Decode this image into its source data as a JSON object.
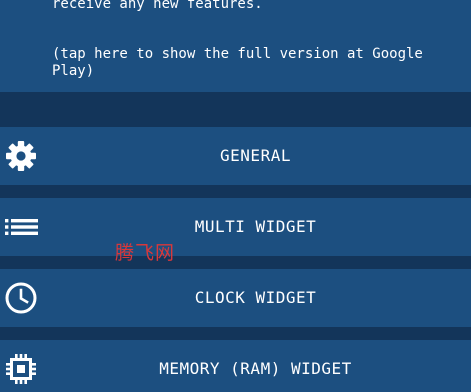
{
  "notice": {
    "line1": "receive any new features.",
    "line2": "(tap here to show the full version at Google",
    "line3": "Play)"
  },
  "menu": {
    "items": [
      {
        "label": "GENERAL",
        "icon": "gear-icon"
      },
      {
        "label": "MULTI WIDGET",
        "icon": "list-icon"
      },
      {
        "label": "CLOCK WIDGET",
        "icon": "clock-icon"
      },
      {
        "label": "MEMORY (RAM) WIDGET",
        "icon": "chip-icon"
      }
    ]
  },
  "watermark": "腾飞网",
  "colors": {
    "background": "#13355a",
    "panel": "#1c4f80",
    "text": "#ffffff",
    "watermark": "#d8383a"
  }
}
